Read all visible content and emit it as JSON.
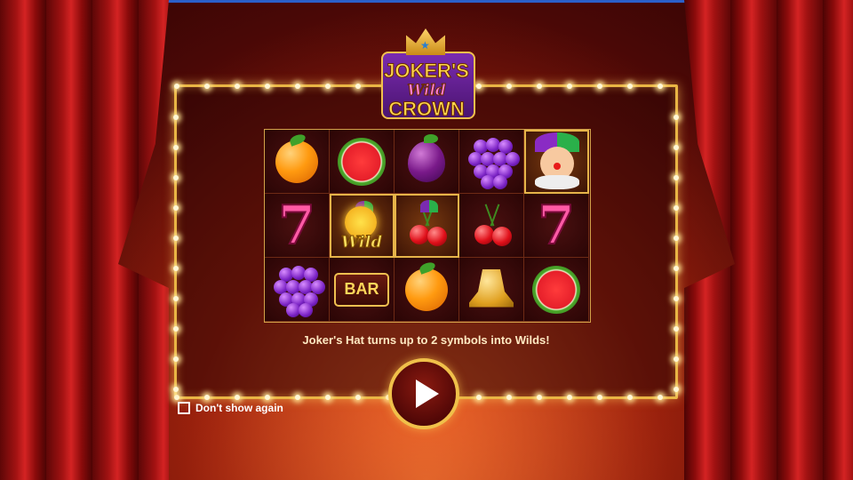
{
  "logo": {
    "line1": "JOKER'S",
    "line2": "Wild",
    "line3": "CROWN"
  },
  "reels": [
    [
      "orange",
      "watermelon",
      "plum",
      "grapes",
      "joker"
    ],
    [
      "seven",
      "wild",
      "cherries-wild",
      "cherries",
      "seven"
    ],
    [
      "grapes",
      "bar",
      "orange",
      "bell",
      "watermelon"
    ]
  ],
  "symbols": {
    "bar_label": "BAR",
    "wild_label": "Wild"
  },
  "description": "Joker's Hat turns up to 2 symbols into Wilds!",
  "play_button": {
    "icon": "play-icon"
  },
  "dont_show": {
    "label": "Don't show again",
    "checked": false
  },
  "colors": {
    "frame_gold": "#e9b544",
    "curtain_red": "#d42323",
    "text_cream": "#ffe9c2"
  }
}
